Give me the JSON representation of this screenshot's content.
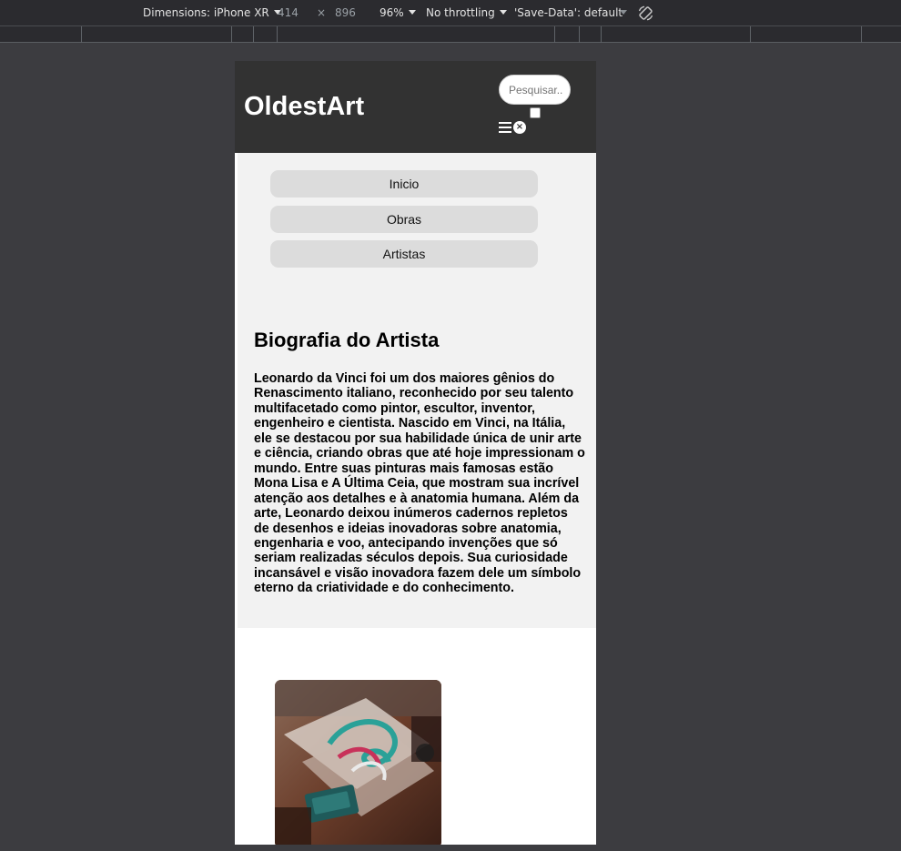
{
  "devtools": {
    "dimensions_label": "Dimensions: iPhone XR",
    "width": "414",
    "times": "×",
    "height": "896",
    "zoom": "96%",
    "throttling": "No throttling",
    "save_data": "'Save-Data': default"
  },
  "site": {
    "logo": "OldestArt",
    "search_placeholder": "Pesquisar...",
    "close_glyph": "×",
    "nav": [
      "Inicio",
      "Obras",
      "Artistas"
    ],
    "bio_title": "Biografia do Artista",
    "bio_text": "Leonardo da Vinci foi um dos maiores gênios do Renascimento italiano, reconhecido por seu talento multifacetado como pintor, escultor, inventor, engenheiro e cientista. Nascido em Vinci, na Itália, ele se destacou por sua habilidade única de unir arte e ciência, criando obras que até hoje impressionam o mundo. Entre suas pinturas mais famosas estão Mona Lisa e A Última Ceia, que mostram sua incrível atenção aos detalhes e à anatomia humana. Além da arte, Leonardo deixou inúmeros cadernos repletos de desenhos e ideias inovadoras sobre anatomia, engenharia e voo, antecipando invenções que só seriam realizadas séculos depois. Sua curiosidade incansável e visão inovadora fazem dele um símbolo eterno da criatividade e do conhecimento."
  },
  "icons": {
    "rotate": "rotate-icon",
    "menu": "hamburger-menu-icon",
    "close": "close-icon"
  }
}
